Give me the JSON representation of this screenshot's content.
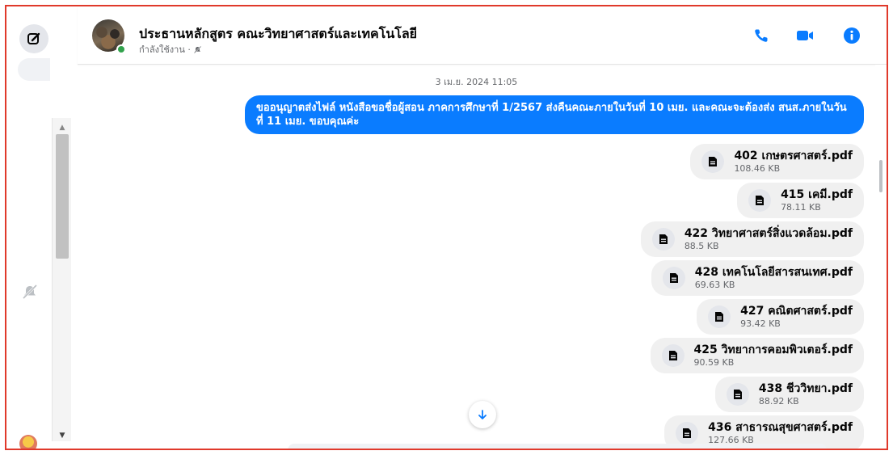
{
  "header": {
    "title": "ประธานหลักสูตร คณะวิทยาศาสตร์และเทคโนโลยี",
    "status": "กำลังใช้งาน ·",
    "status_icon": "muted-bell-icon",
    "accent_color": "#0a7cff",
    "online_color": "#31a24c",
    "actions": [
      "phone-icon",
      "video-camera-icon",
      "info-icon"
    ]
  },
  "conversation": {
    "timestamp": "3 เม.ย. 2024 11:05",
    "message_text": "ขออนุญาตส่งไฟล์ หนังสือขอชื่อผู้สอน ภาคการศึกษาที่ 1/2567 ส่งคืนคณะภายในวันที่ 10 เมย. และคณะจะต้องส่ง สนส.ภายในวันที่ 11 เมย. ขอบคุณค่ะ",
    "bubble_color": "#0a7cff",
    "attachments": [
      {
        "name": "402 เกษตรศาสตร์.pdf",
        "size": "108.46 KB"
      },
      {
        "name": "415 เคมี.pdf",
        "size": "78.11 KB"
      },
      {
        "name": "422 วิทยาศาสตร์สิ่งแวดล้อม.pdf",
        "size": "88.5 KB"
      },
      {
        "name": "428 เทคโนโลยีสารสนเทศ.pdf",
        "size": "69.63 KB"
      },
      {
        "name": "427 คณิตศาสตร์.pdf",
        "size": "93.42 KB"
      },
      {
        "name": "425 วิทยาการคอมพิวเตอร์.pdf",
        "size": "90.59 KB"
      },
      {
        "name": "438 ชีววิทยา.pdf",
        "size": "88.92 KB"
      },
      {
        "name": "436 สาธารณสุขศาสตร์.pdf",
        "size": "127.66 KB"
      }
    ]
  },
  "sidebar": {
    "compose_icon": "compose-icon",
    "muted_icon": "muted-bell-icon"
  }
}
